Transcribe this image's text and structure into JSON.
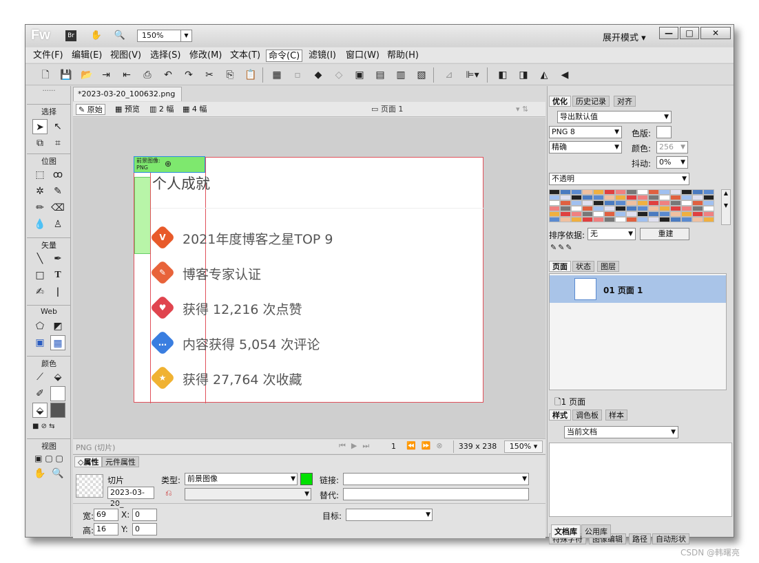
{
  "app": {
    "logo": "Fw",
    "zoom": "150%",
    "mode": "展开模式",
    "min": "—",
    "max": "□",
    "close": "✕"
  },
  "menu": [
    "文件(F)",
    "编辑(E)",
    "视图(V)",
    "选择(S)",
    "修改(M)",
    "文本(T)",
    "命令(C)",
    "滤镜(I)",
    "窗口(W)",
    "帮助(H)"
  ],
  "tools": {
    "select": "选择",
    "bitmap": "位图",
    "vector": "矢量",
    "web": "Web",
    "colors": "颜色",
    "view": "视图"
  },
  "document": {
    "tab": "*2023-03-20_100632.png",
    "close": "×",
    "view_original": "原始",
    "view_preview": "预览",
    "view_2up": "2 幅",
    "view_4up": "4 幅",
    "page": "页面 1"
  },
  "canvas": {
    "slice_label": "前景图像:",
    "slice_format": "PNG",
    "heading": "个人成就",
    "achievements": [
      {
        "text": "2021年度博客之星TOP 9",
        "glyph": "V",
        "color": "#e85a2a"
      },
      {
        "text": "博客专家认证",
        "glyph": "✎",
        "color": "#e8633a"
      },
      {
        "text": "获得 12,216 次点赞",
        "glyph": "♥",
        "color": "#e0444e"
      },
      {
        "text": "内容获得 5,054 次评论",
        "glyph": "…",
        "color": "#3a7ee0"
      },
      {
        "text": "获得 27,764 次收藏",
        "glyph": "★",
        "color": "#f0b232"
      }
    ]
  },
  "status": {
    "info": "PNG (切片)",
    "frame": "1",
    "size": "339 x 238",
    "zoom": "150%"
  },
  "props": {
    "tab1": "属性",
    "tab2": "元件属性",
    "kind": "切片",
    "name": "2023-03-20_",
    "type_label": "类型:",
    "type_value": "前景图像",
    "link_label": "链接:",
    "alt_label": "替代:",
    "target_label": "目标:",
    "w_label": "宽:",
    "w": "69",
    "h_label": "高:",
    "h": "16",
    "x_label": "X:",
    "x": "0",
    "y_label": "Y:",
    "y": "0"
  },
  "optimize": {
    "tab1": "优化",
    "tab2": "历史记录",
    "tab3": "对齐",
    "preset": "导出默认值",
    "format": "PNG 8",
    "palette_label": "色版:",
    "method": "精确",
    "colors_label": "颜色:",
    "colors": "256",
    "dither_label": "抖动:",
    "dither": "0%",
    "transparency": "不透明",
    "sort_label": "排序依据:",
    "sort_value": "无",
    "rebuild": "重建"
  },
  "pages": {
    "tab1": "页面",
    "tab2": "状态",
    "tab3": "图层",
    "item": "01 页面 1",
    "count": "1 页面"
  },
  "styles": {
    "tab1": "样式",
    "tab2": "调色板",
    "tab3": "样本",
    "source": "当前文档"
  },
  "bottomtabs": [
    "特殊字符",
    "图像编辑",
    "路径",
    "自动形状"
  ],
  "bottomtabs2": [
    "文档库",
    "公用库"
  ],
  "watermark": "CSDN @韩曙亮",
  "colors_accent": "#00e000"
}
